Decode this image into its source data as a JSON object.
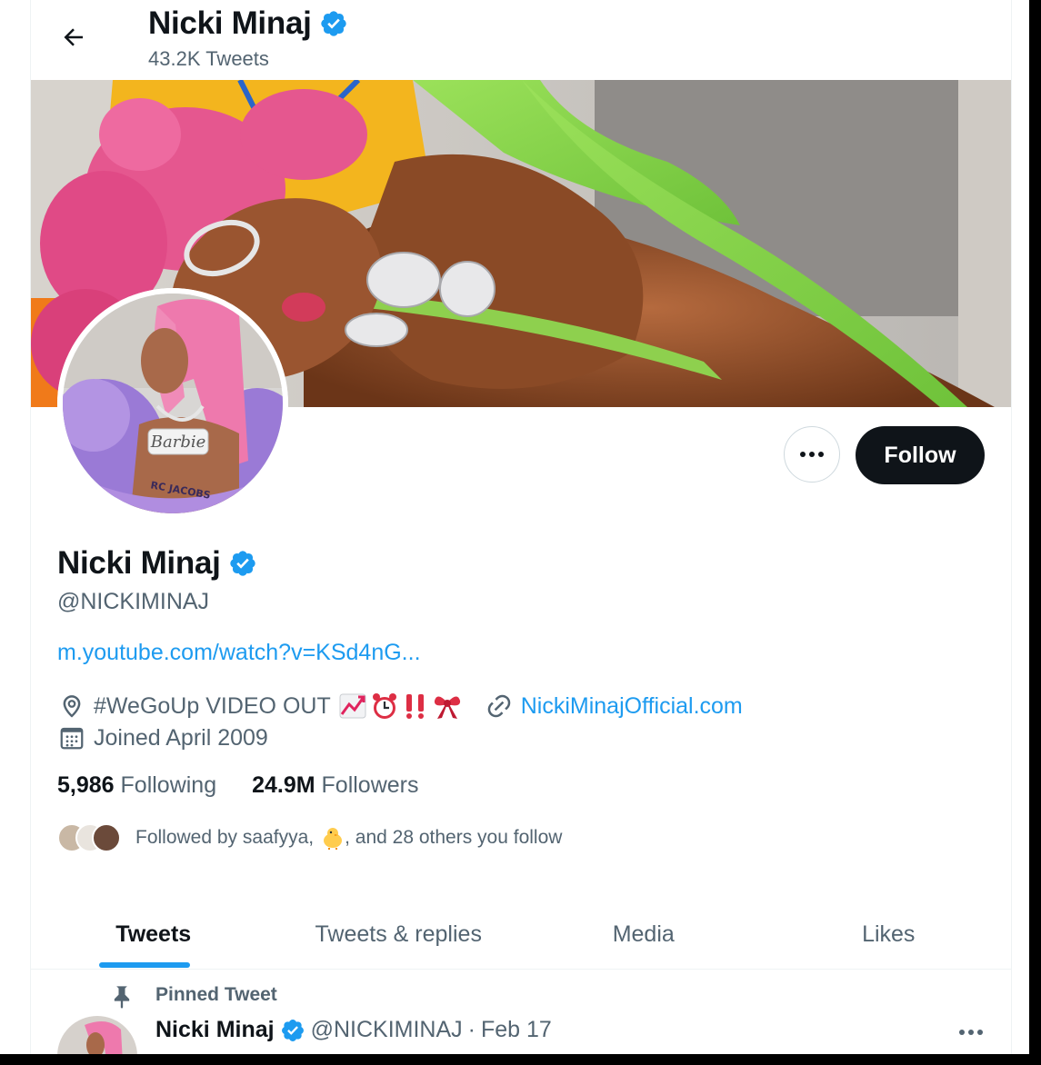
{
  "header": {
    "title": "Nicki Minaj",
    "tweet_count": "43.2K Tweets",
    "back_icon": "arrow-left-icon",
    "verified_icon": "verified-badge-icon"
  },
  "actions": {
    "more_icon": "more-horizontal-icon",
    "follow_label": "Follow"
  },
  "profile": {
    "name": "Nicki Minaj",
    "handle": "@NICKIMINAJ",
    "bio_link": "m.youtube.com/watch?v=KSd4nG...",
    "location": "#WeGoUp VIDEO OUT",
    "location_emojis": [
      "chart-increasing",
      "alarm-clock",
      "double-exclamation",
      "ribbon"
    ],
    "website": "NickiMinajOfficial.com",
    "joined": "Joined April 2009",
    "avatar_text": "Barbie",
    "avatar_shirt_text": "RC JACOBS"
  },
  "stats": {
    "following_count": "5,986",
    "following_label": "Following",
    "followers_count": "24.9M",
    "followers_label": "Followers"
  },
  "followed_by": {
    "prefix": "Followed by saafyya,",
    "emoji": "🐥",
    "suffix": ", and 28 others you follow"
  },
  "tabs": [
    {
      "label": "Tweets",
      "active": true
    },
    {
      "label": "Tweets & replies",
      "active": false
    },
    {
      "label": "Media",
      "active": false
    },
    {
      "label": "Likes",
      "active": false
    }
  ],
  "pinned": {
    "label": "Pinned Tweet",
    "name": "Nicki Minaj",
    "handle": "@NICKIMINAJ",
    "separator": "·",
    "date": "Feb 17"
  },
  "colors": {
    "accent": "#1d9bf0",
    "text_primary": "#0f1419",
    "text_secondary": "#536471",
    "border": "#eff3f4"
  }
}
